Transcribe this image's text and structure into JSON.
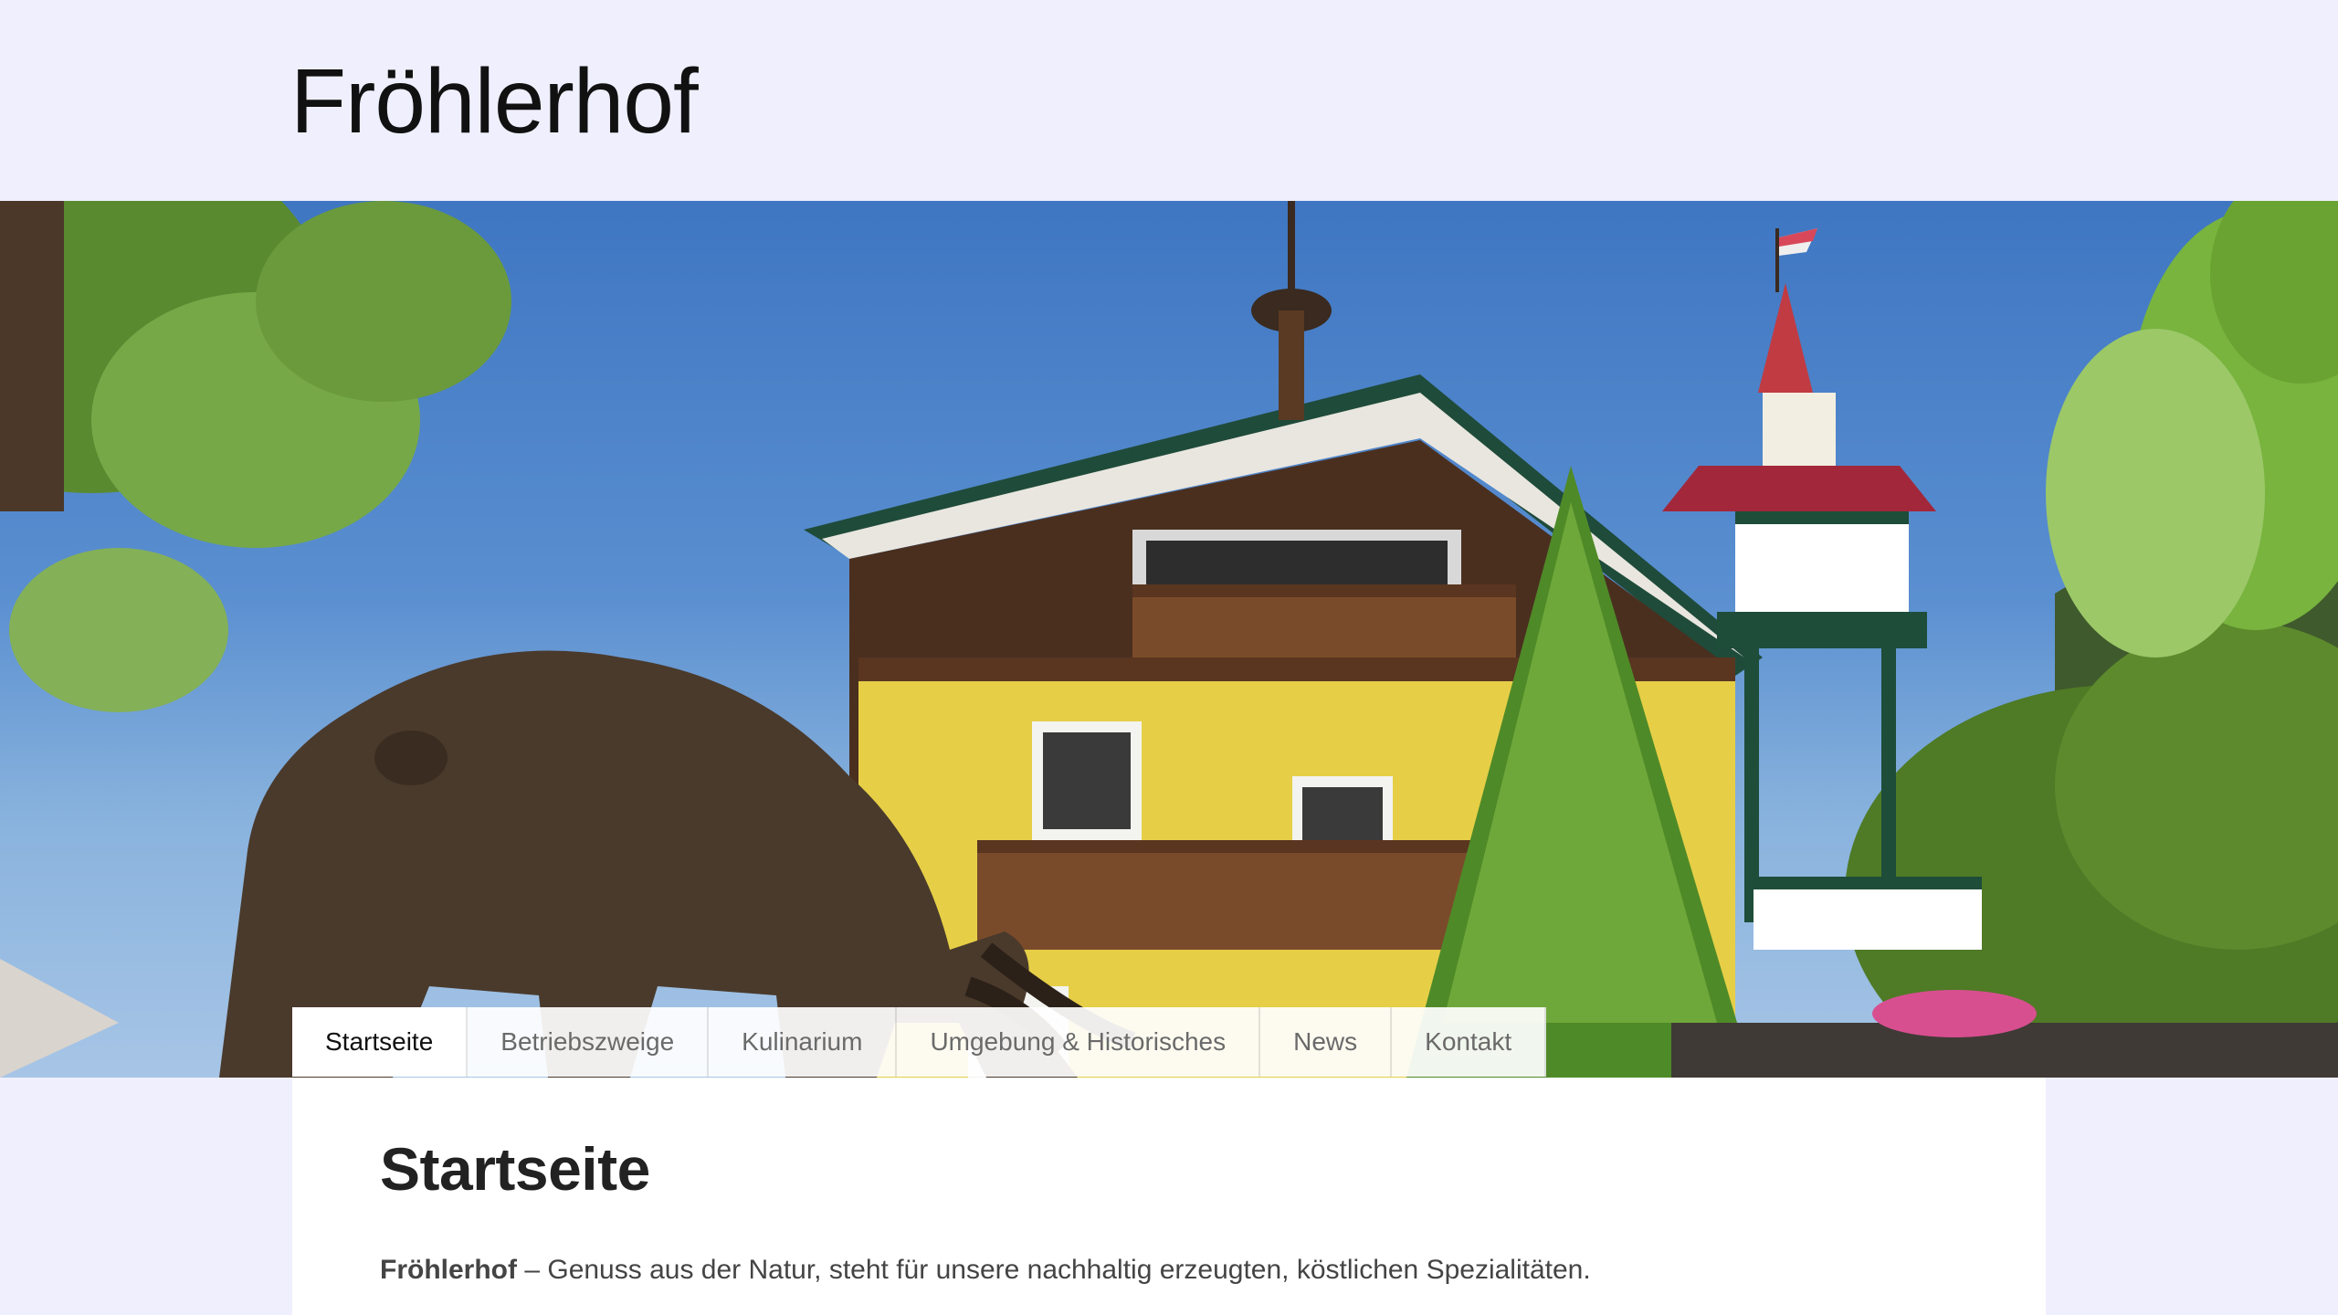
{
  "site": {
    "title": "Fröhlerhof"
  },
  "hero": {
    "image": "farmhouse-with-bull-statue",
    "slides": {
      "count": 2,
      "active_index": 1
    }
  },
  "nav": {
    "items": [
      {
        "label": "Startseite",
        "active": true
      },
      {
        "label": "Betriebszweige",
        "active": false
      },
      {
        "label": "Kulinarium",
        "active": false
      },
      {
        "label": "Umgebung & Historisches",
        "active": false
      },
      {
        "label": "News",
        "active": false
      },
      {
        "label": "Kontakt",
        "active": false
      }
    ]
  },
  "main": {
    "heading": "Startseite",
    "intro_bold": "Fröhlerhof",
    "intro_text": " – Genuss aus der Natur, steht für unsere nachhaltig erzeugten, köstlichen Spezialitäten."
  },
  "colors": {
    "page_background": "#efeffe",
    "content_background": "#ffffff",
    "nav_active_text": "#111111",
    "nav_text": "#6a6a6a"
  }
}
